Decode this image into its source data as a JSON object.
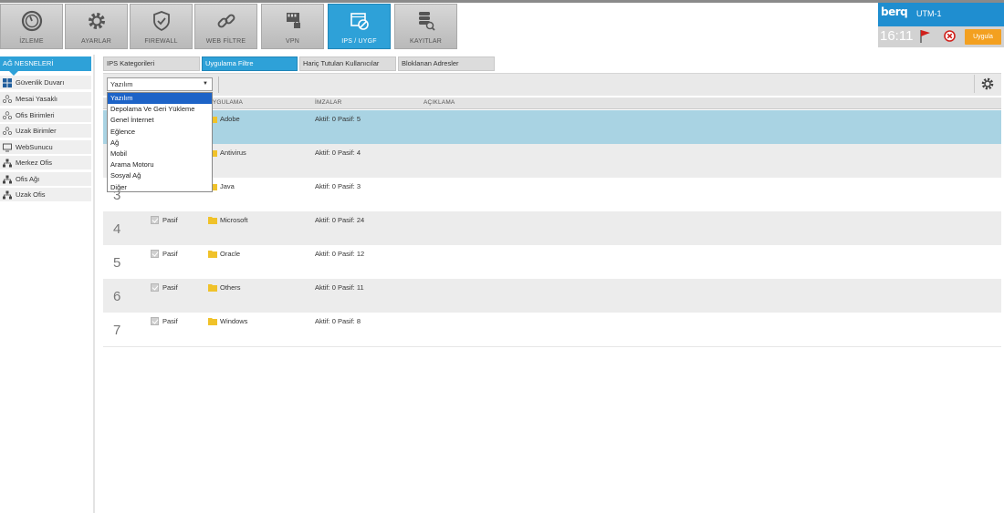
{
  "nav": [
    {
      "label": "İZLEME",
      "icon": "gauge-icon"
    },
    {
      "label": "AYARLAR",
      "icon": "gear-icon"
    },
    {
      "label": "FIREWALL",
      "icon": "shield-icon"
    },
    {
      "label": "WEB FİLTRE",
      "icon": "link-icon"
    },
    {
      "label": "VPN",
      "icon": "vpn-lock-icon"
    },
    {
      "label": "IPS / UYGF",
      "icon": "ips-icon",
      "active": true
    },
    {
      "label": "KAYITLAR",
      "icon": "database-search-icon"
    }
  ],
  "brand": {
    "logo": "berq",
    "device": "UTM-1"
  },
  "status": {
    "time": "16:11",
    "apply_label": "Uygula"
  },
  "sidebar": {
    "heading": "AĞ NESNELERİ",
    "items": [
      {
        "label": "Güvenlik Duvarı",
        "icon": "firewall-grid-icon"
      },
      {
        "label": "Mesai Yasaklı",
        "icon": "group-icon"
      },
      {
        "label": "Ofis Birimleri",
        "icon": "group-icon"
      },
      {
        "label": "Uzak Birimler",
        "icon": "group-icon"
      },
      {
        "label": "WebSunucu",
        "icon": "monitor-icon"
      },
      {
        "label": "Merkez Ofis",
        "icon": "network-icon"
      },
      {
        "label": "Ofis Ağı",
        "icon": "network-icon"
      },
      {
        "label": "Uzak Ofis",
        "icon": "network-icon"
      }
    ]
  },
  "tabs": [
    {
      "label": "IPS Kategorileri"
    },
    {
      "label": "Uygulama Filtre",
      "active": true
    },
    {
      "label": "Hariç Tutulan Kullanıcılar"
    },
    {
      "label": "Bloklanan Adresler"
    }
  ],
  "filter": {
    "selected": "Yazılım",
    "options": [
      "Yazılım",
      "Depolama Ve Geri Yükleme",
      "Genel İnternet",
      "Eğlence",
      "Ağ",
      "Mobil",
      "Arama Motoru",
      "Sosyal Ağ",
      "Diğer"
    ]
  },
  "table": {
    "columns": {
      "app": "UYGULAMA",
      "sig": "İMZALAR",
      "desc": "AÇIKLAMA"
    },
    "rows": [
      {
        "num": "",
        "state": "",
        "app": "Adobe",
        "sig": "Aktif: 0 Pasif: 5"
      },
      {
        "num": "",
        "state": "",
        "app": "Antivirus",
        "sig": "Aktif: 0 Pasif: 4"
      },
      {
        "num": "3",
        "state": "",
        "app": "Java",
        "sig": "Aktif: 0 Pasif: 3"
      },
      {
        "num": "4",
        "state": "Pasif",
        "app": "Microsoft",
        "sig": "Aktif: 0 Pasif: 24"
      },
      {
        "num": "5",
        "state": "Pasif",
        "app": "Oracle",
        "sig": "Aktif: 0 Pasif: 12"
      },
      {
        "num": "6",
        "state": "Pasif",
        "app": "Others",
        "sig": "Aktif: 0 Pasif: 11"
      },
      {
        "num": "7",
        "state": "Pasif",
        "app": "Windows",
        "sig": "Aktif: 0 Pasif: 8"
      }
    ]
  },
  "colors": {
    "accent": "#2ea1d8",
    "selected_row": "#a9d3e3",
    "apply": "#f3a020",
    "flag": "#d0211c"
  }
}
